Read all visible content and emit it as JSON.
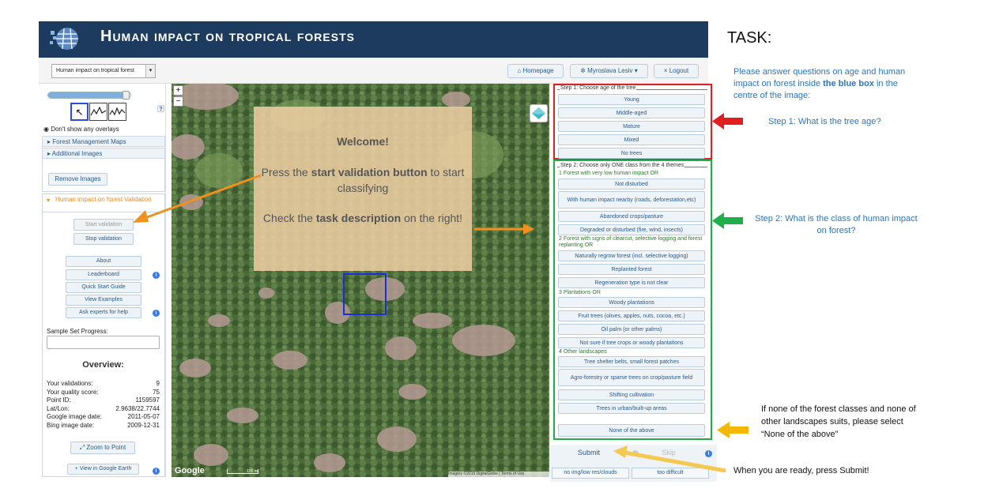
{
  "header": {
    "title": "Human impact on tropical forests"
  },
  "topbar": {
    "project_select": "Human impact on tropical forest",
    "homepage": "Homepage",
    "user": "Myroslava Lesiv",
    "logout": "Logout"
  },
  "sidebar": {
    "dont_show_overlays": "Don't show any overlays",
    "forest_management_maps": "Forest Management Maps",
    "additional_images": "Additional Images",
    "remove_images": "Remove Images",
    "section_title": "Human impact on forest Validation",
    "start_validation": "Start validation",
    "stop_validation": "Stop validation",
    "about": "About",
    "leaderboard": "Leaderboard",
    "quick_start": "Quick Start Guide",
    "view_examples": "View Examples",
    "ask_experts": "Ask experts for help",
    "sample_set_progress": "Sample Set Progress:",
    "overview_title": "Overview:",
    "overview": [
      {
        "label": "Your validations:",
        "value": "9"
      },
      {
        "label": "Your quality score:",
        "value": "75"
      },
      {
        "label": "Point ID:",
        "value": "1159597"
      },
      {
        "label": "Lat/Lon:",
        "value": "2.9638/22.7744"
      },
      {
        "label": "Google image date:",
        "value": "2011-05-07"
      },
      {
        "label": "Bing image date:",
        "value": "2009-12-31"
      }
    ],
    "zoom_to_point": "Zoom to Point",
    "view_google_earth": "View in Google Earth"
  },
  "map": {
    "welcome_title": "Welcome!",
    "welcome_l1a": "Press the ",
    "welcome_l1b": "start validation button",
    "welcome_l1c": " to start classifying",
    "welcome_l2a": "Check the ",
    "welcome_l2b": "task description",
    "welcome_l2c": " on the right!",
    "google": "Google",
    "scale": "100 m",
    "imagery": "Imagery ©2019 DigitalGlobe | Terms of Use",
    "zoom_in": "+",
    "zoom_out": "−"
  },
  "step1": {
    "title": "Step 1: Choose age of the tree",
    "options": [
      "Young",
      "Middle-aged",
      "Mature",
      "Mixed",
      "No trees"
    ]
  },
  "step2": {
    "title": "Step 2: Choose only ONE class from the 4 themes",
    "g1": "1 Forest with very low human impact OR",
    "g1o": [
      "Not disturbed",
      "With human impact nearby (roads, deforestation,etc)",
      "Abandoned crops/pasture",
      "Degraded or disturbed (fire, wind, insects)"
    ],
    "g2": "2 Forest with signs of clearcut, selective logging and forest replanting OR",
    "g2o": [
      "Naturally regrow forest (incl. selective logging)",
      "Replanted forest",
      "Regeneration type is not clear"
    ],
    "g3": "3 Plantations OR",
    "g3o": [
      "Woody plantations",
      "Fruit trees (olives, apples, nuts, cocoa, etc.)",
      "Oil palm (or other palms)",
      "Not sure if tree crops or woody plantations"
    ],
    "g4": "4 Other landscapes",
    "g4o": [
      "Tree shelter belts, small forest patches",
      "Agro-forestry or sparse trees on crop/pasture field",
      "Shifting cultivation",
      "Trees in urban/built-up areas"
    ],
    "none": "None of the above"
  },
  "actions": {
    "submit": "Submit",
    "skip": "Skip",
    "no_img": "no img/low res/clouds",
    "too_difficult": "too difficult"
  },
  "task": {
    "title": "TASK:",
    "intro_a": "Please answer questions on age and human impact on forest inside ",
    "intro_b": "the blue box",
    "intro_c": " in the centre of the image:",
    "step1": "Step 1: What is the tree age?",
    "step2": "Step 2: What is the class of human impact on forest?",
    "none_note": "If none of the forest classes and none of other landscapes suits, please select “None  of the above”",
    "submit_note": "When you are ready, press Submit!"
  },
  "colors": {
    "header_bg": "#1d3b5e",
    "task_blue": "#2e75b6",
    "red_box": "#e02020",
    "green_box": "#1fae4b",
    "orange_arrow": "#f0901e",
    "yellow_arrow": "#f5b800",
    "aoi_box": "#1a2fd6"
  }
}
